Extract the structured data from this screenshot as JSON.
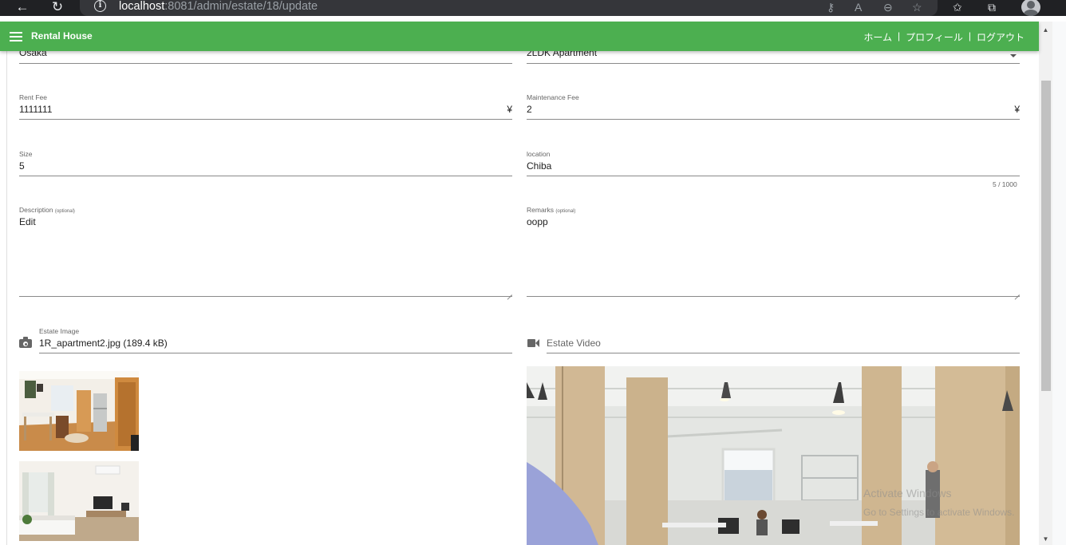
{
  "browser": {
    "url_host": "localhost",
    "url_path": ":8081/admin/estate/18/update"
  },
  "app_bar": {
    "title": "Rental House",
    "links": [
      "ホーム",
      "プロフィール",
      "ログアウト"
    ],
    "separator": "|",
    "color": "#4caf50"
  },
  "form": {
    "prefecture": {
      "value": "Osaka"
    },
    "type": {
      "value": "2LDK Apartment"
    },
    "rent_fee": {
      "label": "Rent Fee",
      "value": "1111111",
      "suffix": "¥"
    },
    "maintenance_fee": {
      "label": "Maintenance Fee",
      "value": "2",
      "suffix": "¥"
    },
    "size": {
      "label": "Size",
      "value": "5"
    },
    "location": {
      "label": "location",
      "value": "Chiba",
      "counter": "5 / 1000"
    },
    "description": {
      "label": "Description",
      "optional": "(optional)",
      "value": "Edit"
    },
    "remarks": {
      "label": "Remarks",
      "optional": "(optional)",
      "value": "oopp"
    },
    "estate_image": {
      "label": "Estate Image",
      "value": "1R_apartment2.jpg (189.4 kB)",
      "icon": "camera-icon"
    },
    "estate_video": {
      "placeholder": "Estate Video",
      "icon": "video-icon"
    }
  },
  "watermark": {
    "line1": "Activate Windows",
    "line2": "Go to Settings to activate Windows."
  }
}
